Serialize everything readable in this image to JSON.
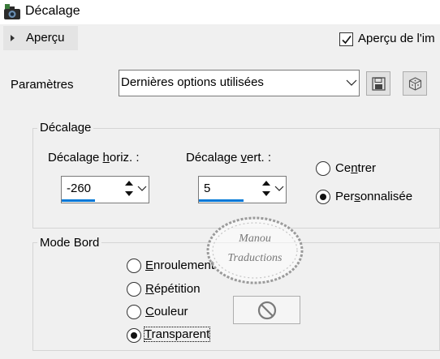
{
  "window": {
    "title": "Décalage",
    "icon": "camera-icon"
  },
  "preview": {
    "expander_label": "Aperçu",
    "expander_icon": "chevron-right-icon",
    "checkbox_label": "Aperçu de l'im",
    "checked": true
  },
  "params": {
    "label": "Paramètres",
    "preset_value": "Dernières options utilisées",
    "save_icon": "save-icon",
    "random_icon": "dice-icon"
  },
  "offset_group": {
    "title": "Décalage",
    "horiz": {
      "pre": "Décalage ",
      "u": "h",
      "post": "oriz. :",
      "value": "-260"
    },
    "vert": {
      "pre": "Décalage ",
      "u": "v",
      "post": "ert. :",
      "value": "5"
    },
    "radios": [
      {
        "pre": "Ce",
        "u": "n",
        "post": "trer",
        "selected": false
      },
      {
        "pre": "Per",
        "u": "s",
        "post": "onnalisée",
        "selected": true
      }
    ]
  },
  "edge_group": {
    "title": "Mode Bord",
    "radios": [
      {
        "pre": "",
        "u": "E",
        "post": "nroulement",
        "selected": false
      },
      {
        "pre": "",
        "u": "R",
        "post": "épétition",
        "selected": false
      },
      {
        "pre": "",
        "u": "C",
        "post": "ouleur",
        "selected": false
      },
      {
        "pre": "",
        "u": "T",
        "post": "ransparent",
        "selected": true
      }
    ],
    "color_button_icon": "no-entry-icon"
  },
  "watermark": {
    "line1": "Manou",
    "line2": "Traductions"
  },
  "colors": {
    "accent": "#0078d7",
    "background": "#f0f0f0",
    "titlebar": "#ffffff"
  }
}
